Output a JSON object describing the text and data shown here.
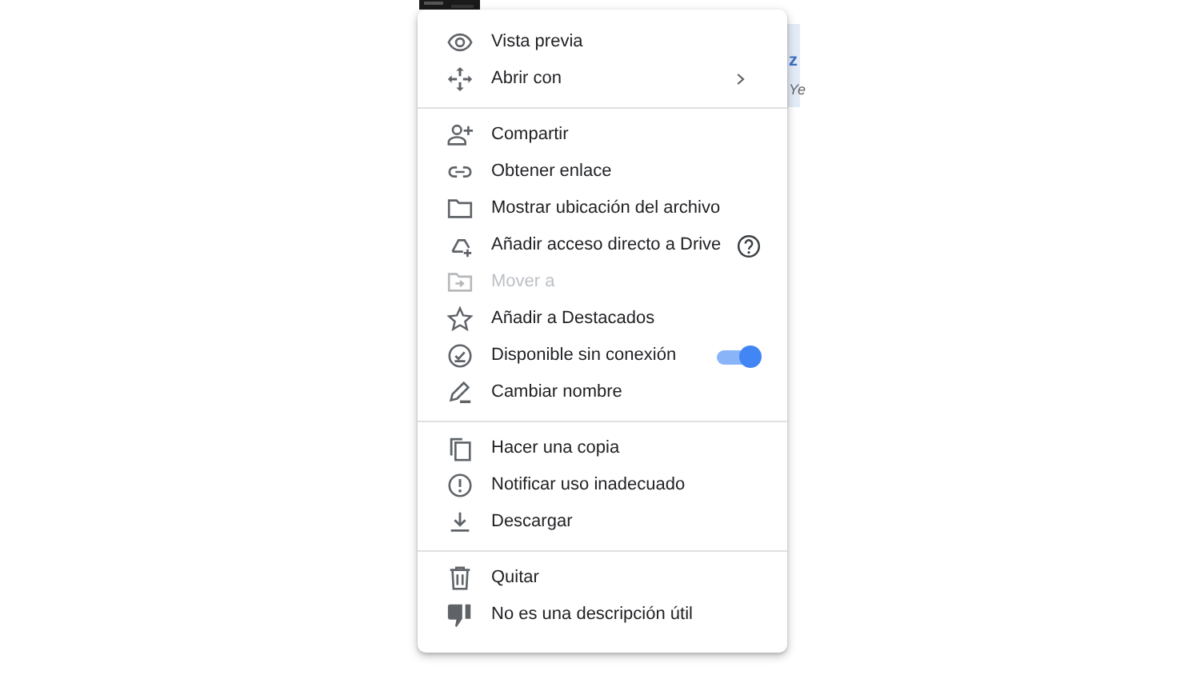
{
  "background": {
    "thumbnail": {
      "kind": "picture"
    },
    "side_panel_texts": [
      "z",
      "Ye"
    ]
  },
  "menu": {
    "sections": [
      [
        {
          "label": "Vista previa",
          "disabled": false
        },
        {
          "label": "Abrir con",
          "disabled": false,
          "trailing": {
            "kind": "submenu"
          }
        }
      ],
      [
        {
          "label": "Compartir",
          "disabled": false
        },
        {
          "label": "Obtener enlace",
          "disabled": false
        },
        {
          "label": "Mostrar ubicación del archivo",
          "disabled": false
        },
        {
          "label": "Añadir acceso directo a Drive",
          "disabled": false,
          "trailing": {
            "kind": "help"
          }
        },
        {
          "label": "Mover a",
          "disabled": true
        },
        {
          "label": "Añadir a Destacados",
          "disabled": false
        },
        {
          "label": "Disponible sin conexión",
          "disabled": false,
          "trailing": {
            "kind": "toggle",
            "on": true
          }
        },
        {
          "label": "Cambiar nombre",
          "disabled": false
        }
      ],
      [
        {
          "label": "Hacer una copia",
          "disabled": false
        },
        {
          "label": "Notificar uso inadecuado",
          "disabled": false
        },
        {
          "label": "Descargar",
          "disabled": false
        }
      ],
      [
        {
          "label": "Quitar",
          "disabled": false
        },
        {
          "label": "No es una descripción útil",
          "disabled": false
        }
      ]
    ]
  }
}
